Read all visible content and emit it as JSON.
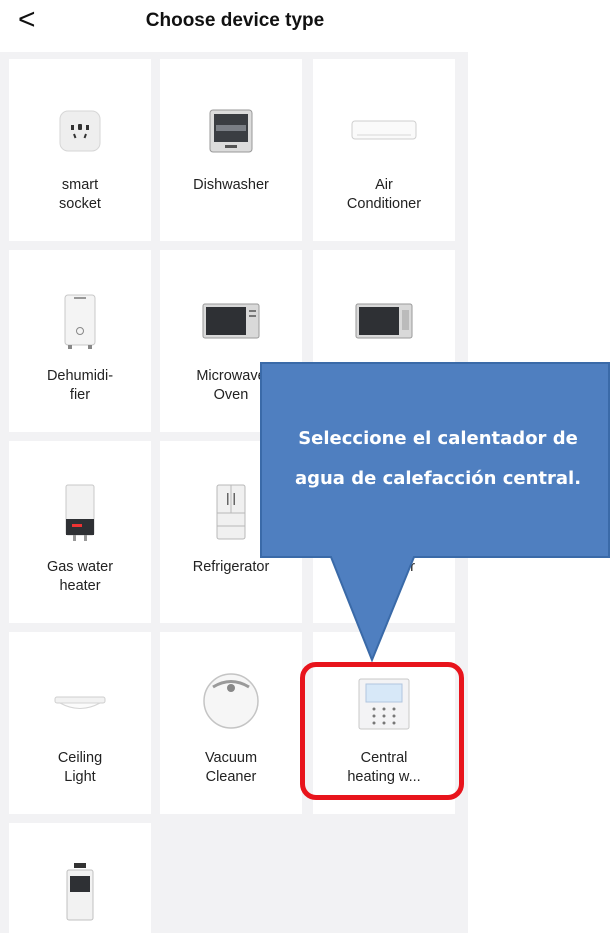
{
  "header": {
    "back_glyph": "<",
    "title": "Choose device type"
  },
  "devices": [
    {
      "label": "smart\nsocket",
      "icon": "smart-socket-icon"
    },
    {
      "label": "Dishwasher",
      "icon": "dishwasher-icon"
    },
    {
      "label": "Air\nConditioner",
      "icon": "air-conditioner-icon"
    },
    {
      "label": "Dehumidi-\nfier",
      "icon": "dehumidifier-icon"
    },
    {
      "label": "Microwave\nOven",
      "icon": "microwave-icon"
    },
    {
      "label": "",
      "icon": "oven-icon"
    },
    {
      "label": "Gas water\nheater",
      "icon": "gas-water-heater-icon"
    },
    {
      "label": "Refrigerator",
      "icon": "refrigerator-icon"
    },
    {
      "label": "er",
      "icon": ""
    },
    {
      "label": "Ceiling\nLight",
      "icon": "ceiling-light-icon"
    },
    {
      "label": "Vacuum\nCleaner",
      "icon": "vacuum-cleaner-icon"
    },
    {
      "label": "Central\nheating w...",
      "icon": "central-heating-icon"
    },
    {
      "label": "",
      "icon": "tower-appliance-icon"
    }
  ],
  "callout": {
    "text": "Seleccione el calentador de\nagua de calefacción central."
  },
  "colors": {
    "callout_fill": "#4f7fc0",
    "callout_border": "#3a6aa8",
    "highlight": "#e8141c",
    "grid_bg": "#f2f2f4"
  }
}
